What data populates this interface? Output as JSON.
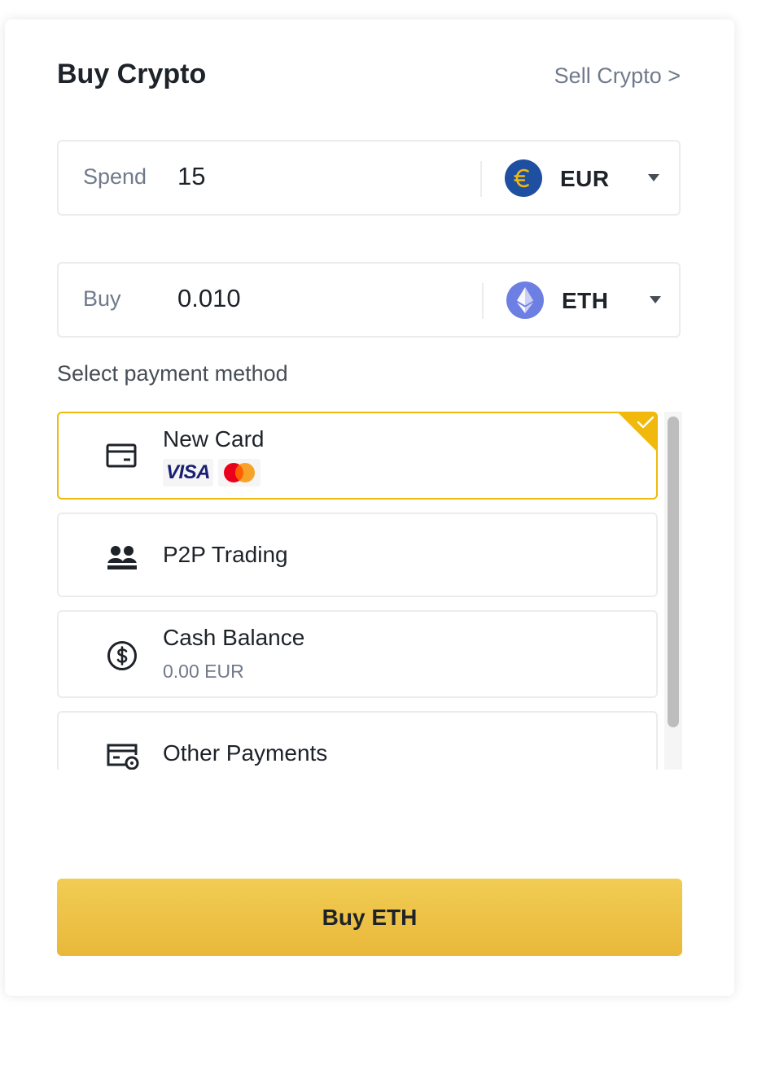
{
  "header": {
    "title": "Buy Crypto",
    "sell_link": "Sell Crypto >"
  },
  "spend": {
    "label": "Spend",
    "value": "15",
    "currency": "EUR",
    "currency_icon": "euro-coin-icon"
  },
  "buy": {
    "label": "Buy",
    "value": "0.010",
    "currency": "ETH",
    "currency_icon": "ethereum-coin-icon"
  },
  "payment": {
    "section_label": "Select payment method",
    "methods": [
      {
        "name": "New Card",
        "icon": "credit-card-icon",
        "badges": [
          "VISA",
          "MasterCard"
        ],
        "selected": true
      },
      {
        "name": "P2P Trading",
        "icon": "users-icon"
      },
      {
        "name": "Cash Balance",
        "icon": "dollar-circle-icon",
        "balance": "0.00 EUR"
      },
      {
        "name": "Other Payments",
        "icon": "payment-card-settings-icon"
      }
    ]
  },
  "cta": {
    "label": "Buy ETH"
  },
  "colors": {
    "accent": "#f0b90b",
    "button": "#f0c94a",
    "text": "#1e2329",
    "muted": "#707a8a",
    "border": "#eaecef"
  }
}
